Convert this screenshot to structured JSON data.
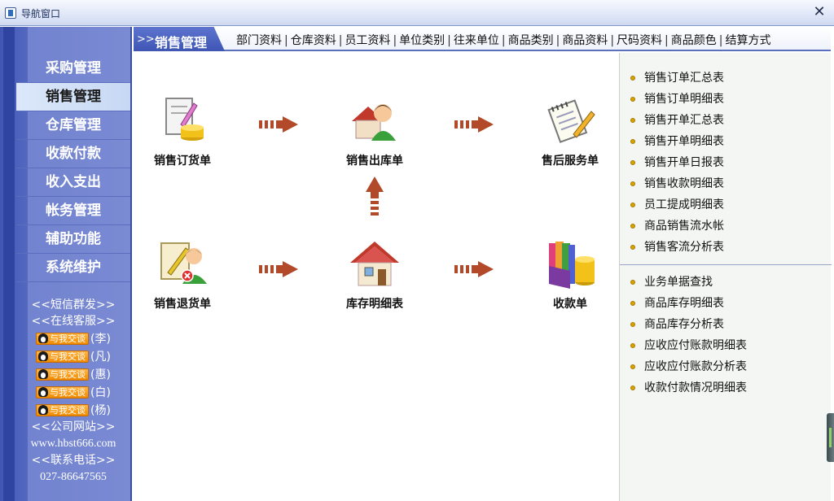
{
  "window": {
    "title": "导航窗口",
    "close_glyph": "✕"
  },
  "sidebar": {
    "menu": [
      {
        "label": "采购管理",
        "active": false
      },
      {
        "label": "销售管理",
        "active": true
      },
      {
        "label": "仓库管理",
        "active": false
      },
      {
        "label": "收款付款",
        "active": false
      },
      {
        "label": "收入支出",
        "active": false
      },
      {
        "label": "帐务管理",
        "active": false
      },
      {
        "label": "辅助功能",
        "active": false
      },
      {
        "label": "系统维护",
        "active": false
      }
    ],
    "sms_link": "<<短信群发>>",
    "service_link": "<<在线客服>>",
    "qq_button_label": "与我交谈",
    "contacts": [
      "(李)",
      "(凡)",
      "(惠)",
      "(白)",
      "(杨)"
    ],
    "website_label": "<<公司网站>>",
    "website_url": "www.hbst666.com",
    "phone_label": "<<联系电话>>",
    "phone": "027-86647565"
  },
  "topnav": {
    "arrows": ">>",
    "section": "销售管理",
    "links": [
      "部门资料",
      "仓库资料",
      "员工资料",
      "单位类别",
      "往来单位",
      "商品类别",
      "商品资料",
      "尺码资料",
      "商品颜色",
      "结算方式"
    ],
    "separator": "|"
  },
  "flow": {
    "nodes": {
      "sales_order": "销售订货单",
      "sales_outbound": "销售出库单",
      "after_sales": "售后服务单",
      "sales_return": "销售退货单",
      "inventory_detail": "库存明细表",
      "receipt": "收款单"
    }
  },
  "reports": {
    "group1": [
      "销售订单汇总表",
      "销售订单明细表",
      "销售开单汇总表",
      "销售开单明细表",
      "销售开单日报表",
      "销售收款明细表",
      "员工提成明细表",
      "商品销售流水帐",
      "销售客流分析表"
    ],
    "group2": [
      "业务单据查找",
      "商品库存明细表",
      "商品库存分析表",
      "应收应付账款明细表",
      "应收应付账款分析表",
      "收款付款情况明细表"
    ]
  },
  "colors": {
    "sidebar": "#7a8ad3",
    "active": "#dce8fa",
    "arrow": "#b24a2a",
    "bullet": "#d8a300"
  }
}
